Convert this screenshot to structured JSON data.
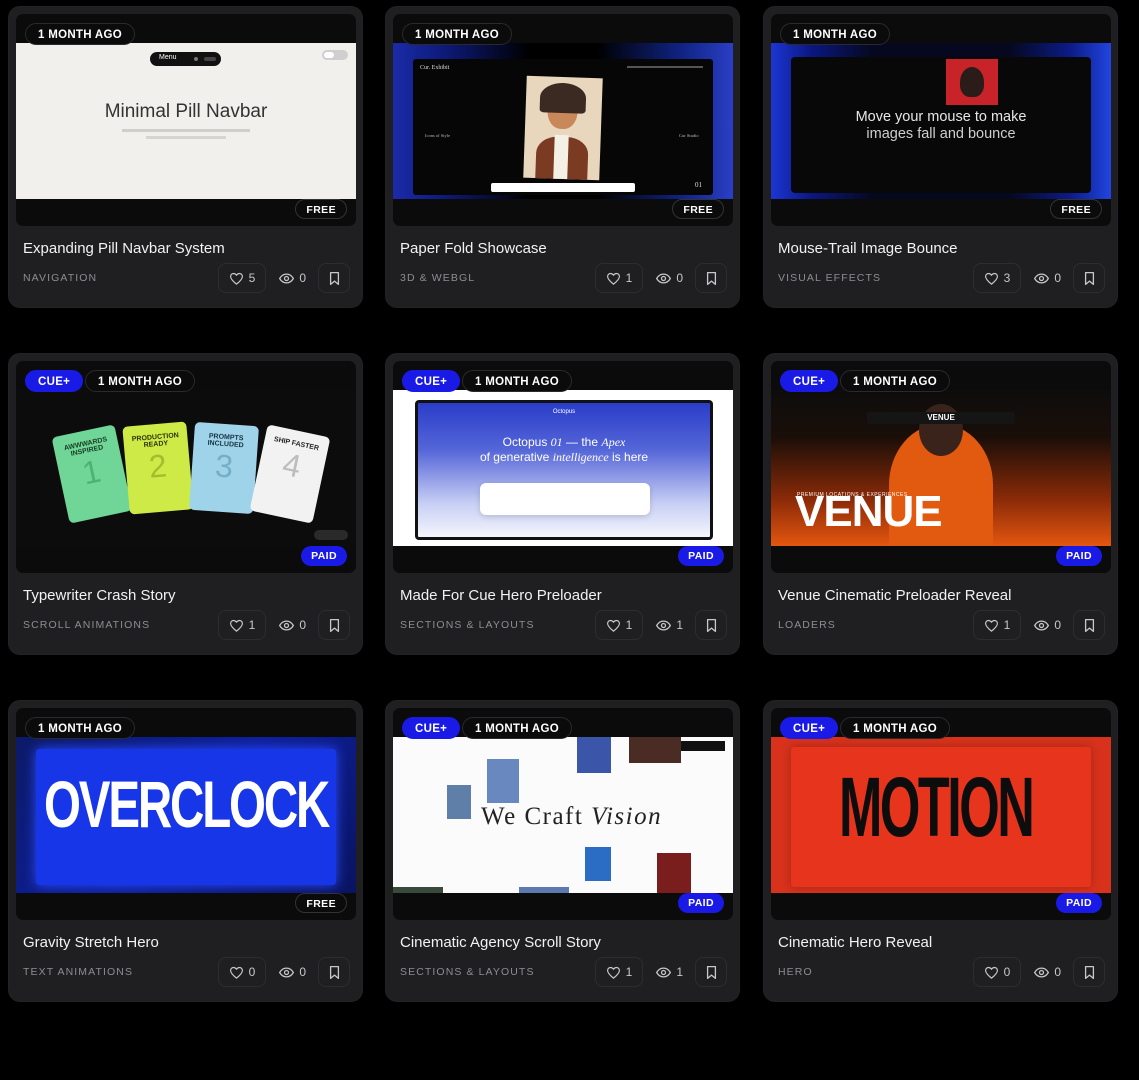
{
  "cards": [
    {
      "time": "1 MONTH AGO",
      "plan": "FREE",
      "title": "Expanding Pill Navbar System",
      "category": "NAVIGATION",
      "likes": "5",
      "views": "0",
      "preview": {
        "heading": "Minimal Pill Navbar",
        "menu": "Menu"
      }
    },
    {
      "time": "1 MONTH AGO",
      "plan": "FREE",
      "title": "Paper Fold Showcase",
      "category": "3D & WEBGL",
      "likes": "1",
      "views": "0",
      "preview": {
        "brand": "Cur. Exhibit",
        "left": "Icons of Style",
        "right": "Cur Studio",
        "page": "01"
      }
    },
    {
      "time": "1 MONTH AGO",
      "plan": "FREE",
      "title": "Mouse-Trail Image Bounce",
      "category": "VISUAL EFFECTS",
      "likes": "3",
      "views": "0",
      "preview": {
        "line1": "Move your mouse to make",
        "line2": "images fall and bounce"
      }
    },
    {
      "cue": "CUE+",
      "time": "1 MONTH AGO",
      "plan": "PAID",
      "title": "Typewriter Crash Story",
      "category": "SCROLL ANIMATIONS",
      "likes": "1",
      "views": "0",
      "preview": {
        "cards": [
          {
            "label": "AWWWARDS INSPIRED",
            "num": "1"
          },
          {
            "label": "PRODUCTION READY",
            "num": "2"
          },
          {
            "label": "PROMPTS INCLUDED",
            "num": "3"
          },
          {
            "label": "SHIP FASTER",
            "num": "4"
          }
        ]
      }
    },
    {
      "cue": "CUE+",
      "time": "1 MONTH AGO",
      "plan": "PAID",
      "title": "Made For Cue Hero Preloader",
      "category": "SECTIONS & LAYOUTS",
      "likes": "1",
      "views": "1",
      "preview": {
        "brand": "Octopus",
        "line1a": "Octopus",
        "line1b": "01",
        "line1c": "— the",
        "line1d": "Apex",
        "line2a": "of generative",
        "line2b": "intelligence",
        "line2c": "is here"
      }
    },
    {
      "cue": "CUE+",
      "time": "1 MONTH AGO",
      "plan": "PAID",
      "title": "Venue Cinematic Preloader Reveal",
      "category": "LOADERS",
      "likes": "1",
      "views": "0",
      "preview": {
        "word": "VENUE",
        "tag": "VENUE",
        "kicker": "PREMIUM LOCATIONS & EXPERIENCES"
      }
    },
    {
      "time": "1 MONTH AGO",
      "plan": "FREE",
      "title": "Gravity Stretch Hero",
      "category": "TEXT ANIMATIONS",
      "likes": "0",
      "views": "0",
      "preview": {
        "word": "OVERCLOCK"
      }
    },
    {
      "cue": "CUE+",
      "time": "1 MONTH AGO",
      "plan": "PAID",
      "title": "Cinematic Agency Scroll Story",
      "category": "SECTIONS & LAYOUTS",
      "likes": "1",
      "views": "1",
      "preview": {
        "word1": "We Craft",
        "word2": "Vision"
      }
    },
    {
      "cue": "CUE+",
      "time": "1 MONTH AGO",
      "plan": "PAID",
      "title": "Cinematic Hero Reveal",
      "category": "HERO",
      "likes": "0",
      "views": "0",
      "preview": {
        "word": "MOTION"
      }
    }
  ]
}
